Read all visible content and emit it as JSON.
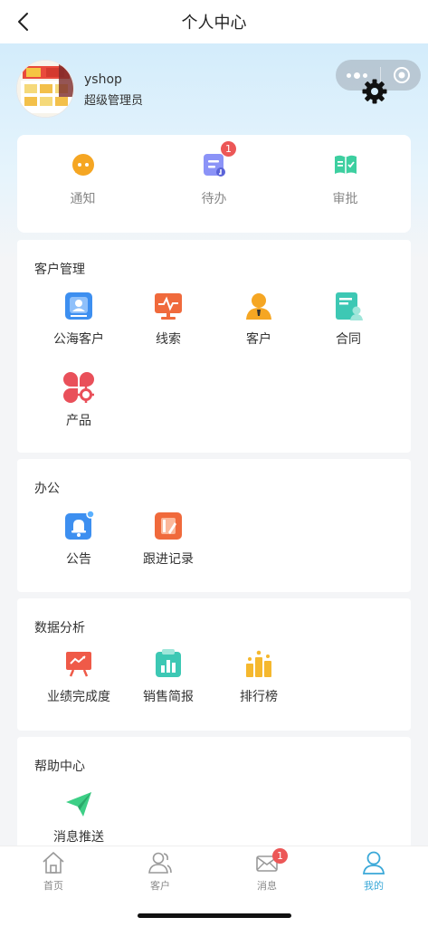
{
  "header": {
    "title": "个人中心",
    "back_icon": "chevron-left-icon"
  },
  "profile": {
    "name": "yshop",
    "role": "超级管理员"
  },
  "quick_actions": [
    {
      "label": "通知",
      "icon": "chat-bubble-icon",
      "color": "#f5a623"
    },
    {
      "label": "待办",
      "icon": "todo-note-icon",
      "color": "#7b84f5",
      "badge": "1"
    },
    {
      "label": "审批",
      "icon": "approval-book-icon",
      "color": "#3dcfa0"
    }
  ],
  "sections": {
    "customer": {
      "title": "客户管理",
      "items": [
        {
          "label": "公海客户",
          "icon": "public-customer-icon",
          "color": "#3d8ff0"
        },
        {
          "label": "线索",
          "icon": "lead-monitor-icon",
          "color": "#f06a3c"
        },
        {
          "label": "客户",
          "icon": "customer-person-icon",
          "color": "#f5a623"
        },
        {
          "label": "合同",
          "icon": "contract-doc-icon",
          "color": "#3dc8b4"
        },
        {
          "label": "产品",
          "icon": "product-grid-icon",
          "color": "#e9505a"
        }
      ]
    },
    "office": {
      "title": "办公",
      "items": [
        {
          "label": "公告",
          "icon": "announcement-bell-icon",
          "color": "#3d8ff0"
        },
        {
          "label": "跟进记录",
          "icon": "followup-record-icon",
          "color": "#f06a3c"
        }
      ]
    },
    "analysis": {
      "title": "数据分析",
      "items": [
        {
          "label": "业绩完成度",
          "icon": "performance-board-icon",
          "color": "#ef5a48"
        },
        {
          "label": "销售简报",
          "icon": "sales-report-icon",
          "color": "#3dc8b4"
        },
        {
          "label": "排行榜",
          "icon": "ranking-bars-icon",
          "color": "#f5b82e"
        }
      ]
    },
    "help": {
      "title": "帮助中心",
      "items": [
        {
          "label": "消息推送",
          "icon": "paper-plane-icon",
          "color": "#3dcf86"
        }
      ]
    }
  },
  "tabbar": [
    {
      "label": "首页",
      "icon": "home-icon"
    },
    {
      "label": "客户",
      "icon": "customers-icon"
    },
    {
      "label": "消息",
      "icon": "mail-icon",
      "badge": "1"
    },
    {
      "label": "我的",
      "icon": "profile-icon",
      "active": true
    }
  ],
  "colors": {
    "accent": "#3aa8d8",
    "badge": "#ec5757"
  }
}
